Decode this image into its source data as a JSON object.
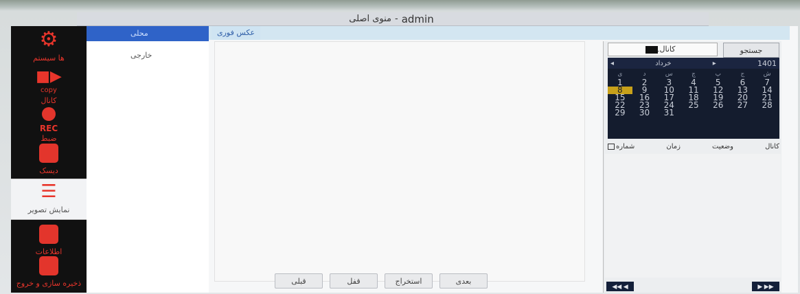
{
  "window": {
    "title_prefix": "منوی اصلی",
    "separator": "-",
    "user": "admin"
  },
  "sidebar": [
    {
      "label": "ها سیستم",
      "icon": "gear-icon"
    },
    {
      "label": "کانال",
      "icon": "camera-icon",
      "sub": "copy"
    },
    {
      "label": "ضبط",
      "icon": "record-icon",
      "sub": "REC"
    },
    {
      "label": "دیسک",
      "icon": "disk-icon"
    },
    {
      "label": "نمایش تصویر",
      "icon": "document-icon"
    },
    {
      "label": "اطلاعات",
      "icon": "edit-icon"
    },
    {
      "label": "ذخیره سازی و خروج",
      "icon": "save-icon"
    }
  ],
  "submenu": {
    "items": [
      "محلی",
      "خارجی"
    ]
  },
  "main": {
    "tab": "عکس فوری"
  },
  "buttons": {
    "next": "بعدی",
    "extract": "استخراج",
    "lock": "قفل",
    "prev": "قبلی"
  },
  "search": {
    "channel_text": "01کانال",
    "button": "جستجو"
  },
  "calendar": {
    "year": "1401",
    "month": "خرداد",
    "weekdays": [
      "ش",
      "ج",
      "پ",
      "چ",
      "س",
      "د",
      "ی"
    ],
    "days": [
      "1",
      "2",
      "3",
      "4",
      "5",
      "6",
      "7",
      "8",
      "9",
      "10",
      "11",
      "12",
      "13",
      "14",
      "15",
      "16",
      "17",
      "18",
      "19",
      "20",
      "21",
      "22",
      "23",
      "24",
      "25",
      "26",
      "27",
      "28",
      "29",
      "30",
      "31"
    ],
    "selected_day": "8",
    "colors": {
      "selected": "#c8a11a",
      "background": "#141c2e"
    }
  },
  "list": {
    "columns": [
      "کانال",
      "وضعیت",
      "زمان",
      "شماره"
    ]
  },
  "pager": {
    "first": "◀◀",
    "prev": "◀",
    "next": "▶",
    "last": "▶▶"
  },
  "colors": {
    "accent": "#e8352b",
    "selected_tab": "#2f63c8"
  }
}
